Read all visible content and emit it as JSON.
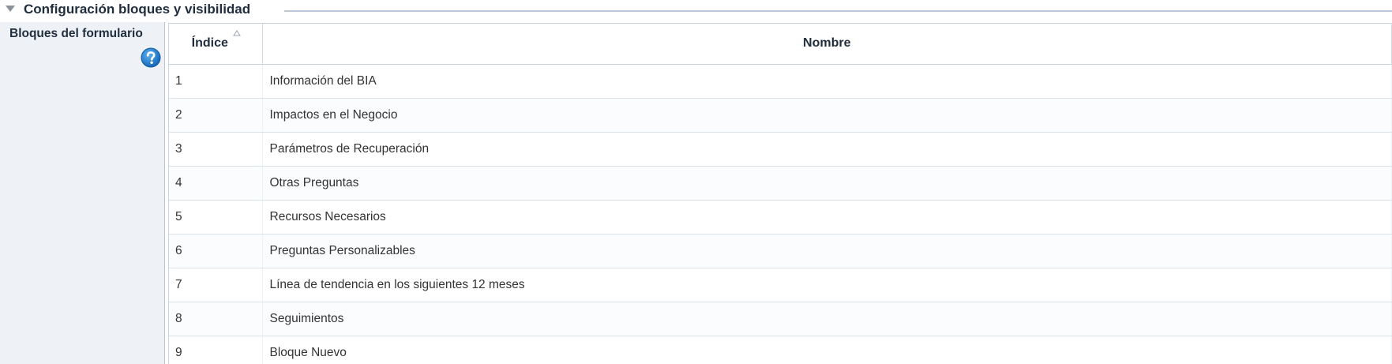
{
  "section": {
    "title": "Configuración bloques y visibilidad"
  },
  "field": {
    "label": "Bloques del formulario"
  },
  "icons": {
    "collapse": "triangle-down-icon",
    "help": "question-mark-icon",
    "sort": "sort-ascending-icon"
  },
  "colors": {
    "help_icon": "#1e7fd3",
    "section_rule": "#b9cbdc",
    "label_panel_bg": "#eef2f6"
  },
  "table": {
    "columns": [
      "Índice",
      "Nombre"
    ],
    "sorted_column": "Índice",
    "sort_direction": "ascending",
    "rows": [
      {
        "index": "1",
        "name": "Información del BIA"
      },
      {
        "index": "2",
        "name": "Impactos en el Negocio"
      },
      {
        "index": "3",
        "name": "Parámetros de Recuperación"
      },
      {
        "index": "4",
        "name": "Otras Preguntas"
      },
      {
        "index": "5",
        "name": "Recursos Necesarios"
      },
      {
        "index": "6",
        "name": "Preguntas Personalizables"
      },
      {
        "index": "7",
        "name": "Línea de tendencia en los siguientes 12 meses"
      },
      {
        "index": "8",
        "name": "Seguimientos"
      },
      {
        "index": "9",
        "name": "Bloque Nuevo"
      }
    ]
  }
}
